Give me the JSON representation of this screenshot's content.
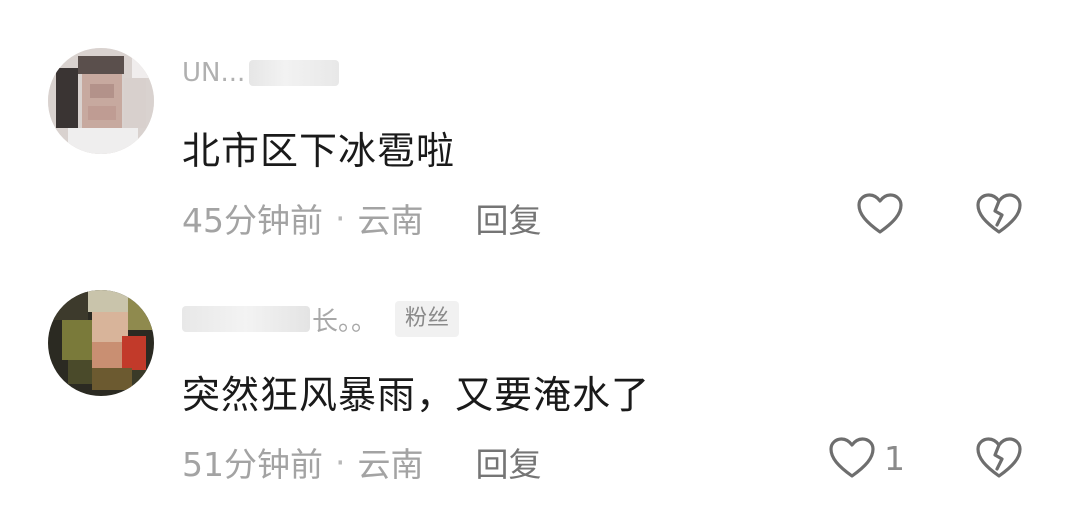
{
  "comments": [
    {
      "username": "UN...",
      "content": "北市区下冰雹啦",
      "time": "45分钟前",
      "separator": "·",
      "location": "云南",
      "reply_label": "回复",
      "like_count": "",
      "like_icon": "heart-outline-icon",
      "dislike_icon": "broken-heart-icon"
    },
    {
      "username": "长。。",
      "badge": "粉丝",
      "content": "突然狂风暴雨，又要淹水了",
      "time": "51分钟前",
      "separator": "·",
      "location": "云南",
      "reply_label": "回复",
      "like_count": "1",
      "like_icon": "heart-outline-icon",
      "dislike_icon": "broken-heart-icon"
    }
  ],
  "colors": {
    "text_primary": "#1a1a1a",
    "text_secondary": "#a3a3a3",
    "reply": "#757575",
    "icon_stroke": "#6e6e6e",
    "badge_bg": "#f1f1f1"
  }
}
